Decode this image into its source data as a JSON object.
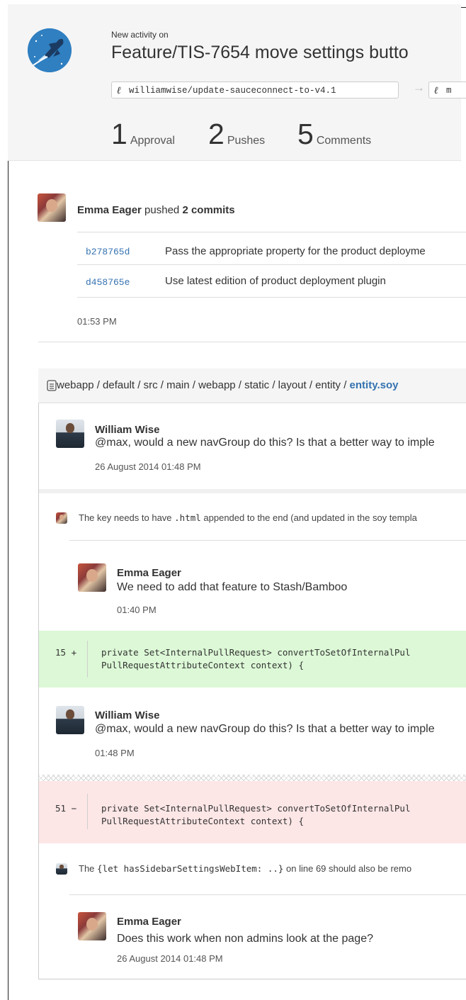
{
  "header": {
    "kicker": "New activity on",
    "title": "Feature/TIS-7654 move settings butto",
    "source_branch": "williamwise/update-sauceconnect-to-v4.1",
    "target_branch": "m",
    "branch_icon": "ℓ",
    "arrow": "→",
    "stats": [
      {
        "count": "1",
        "label": "Approval"
      },
      {
        "count": "2",
        "label": "Pushes"
      },
      {
        "count": "5",
        "label": "Comments"
      }
    ]
  },
  "push": {
    "author": "Emma Eager",
    "action": " pushed ",
    "count_text": "2 commits",
    "commits": [
      {
        "hash": "b278765d",
        "message": "Pass the appropriate property for the product deployme"
      },
      {
        "hash": "d458765e",
        "message": "Use latest edition of product deployment plugin"
      }
    ],
    "time": "01:53 PM"
  },
  "file": {
    "path_prefix": "webapp / default / src / main / webapp / static / layout / entity / ",
    "filename": "entity.soy",
    "comments": [
      {
        "author": "William Wise",
        "text": "@max, would a new navGroup do this? Is that a better way to imple",
        "time": "26 August 2014 01:48 PM"
      }
    ],
    "outdated1": {
      "pre": "The key needs to have ",
      "code": ".html",
      "post": " appended to the end (and updated in the soy templa"
    },
    "reply1": {
      "author": "Emma Eager",
      "text": "We need to add that feature to Stash/Bamboo",
      "time": "01:40 PM"
    },
    "diff_add": {
      "line": "15",
      "sign": "+",
      "code1": "private Set<InternalPullRequest> convertToSetOfInternalPul",
      "code2": "PullRequestAttributeContext context) {"
    },
    "comment2": {
      "author": "William Wise",
      "text": "@max, would a new navGroup do this? Is that a better way to imple",
      "time": "01:48 PM"
    },
    "diff_del": {
      "line": "51",
      "sign": "−",
      "code1": "private Set<InternalPullRequest> convertToSetOfInternalPul",
      "code2": "PullRequestAttributeContext context) {"
    },
    "outdated2": {
      "pre": "The ",
      "code": "{let hasSidebarSettingsWebItem: ..}",
      "post": " on line 69 should also be remo"
    },
    "reply2": {
      "author": "Emma Eager",
      "text": "Does this work when non admins look at the page?",
      "time": "26 August 2014 01:48 PM"
    }
  }
}
